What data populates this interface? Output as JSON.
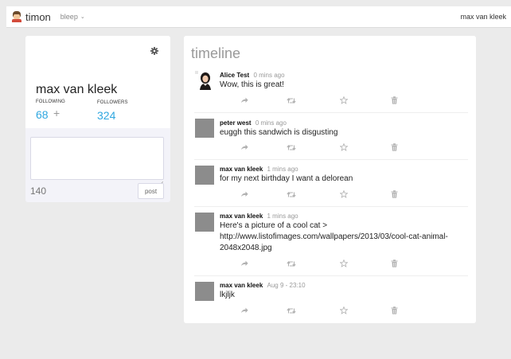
{
  "navbar": {
    "brand": "timon",
    "switcher_label": "bleep",
    "switcher_caret": "⌄",
    "user_name": "max van kleek"
  },
  "profile": {
    "name": "max van kleek",
    "following_label": "FOLLOWING",
    "followers_label": "FOLLOWERS",
    "following_count": "68",
    "followers_count": "324",
    "add_follow": "+"
  },
  "composer": {
    "value": "",
    "placeholder": "",
    "char_count": "140",
    "post_label": "post"
  },
  "timeline": {
    "title": "timeline",
    "posts": [
      {
        "author": "Alice Test",
        "time": "0 mins ago",
        "text": "Wow, this is great!",
        "avatar": "photo"
      },
      {
        "author": "peter west",
        "time": "0 mins ago",
        "text": "euggh this sandwich is disgusting",
        "avatar": "grey"
      },
      {
        "author": "max van kleek",
        "time": "1 mins ago",
        "text": "for my next birthday I want a delorean",
        "avatar": "grey"
      },
      {
        "author": "max van kleek",
        "time": "1 mins ago",
        "text": "Here's a picture of a cool cat > http://www.listofimages.com/wallpapers/2013/03/cool-cat-animal-2048x2048.jpg",
        "avatar": "grey"
      },
      {
        "author": "max van kleek",
        "time": "Aug 9 - 23:10",
        "text": "lkjljk",
        "avatar": "grey"
      }
    ]
  },
  "icons": {
    "settings": "gear-icon",
    "reply": "reply-arrow-icon",
    "repost": "repost-icon",
    "favorite": "star-icon",
    "delete": "trash-icon"
  },
  "colors": {
    "accent": "#2fa7e0",
    "page_bg": "#ebebeb",
    "compose_bg": "#f3f3f9",
    "avatar_grey": "#8c8c8c",
    "icon_grey": "#b0b0b0"
  }
}
